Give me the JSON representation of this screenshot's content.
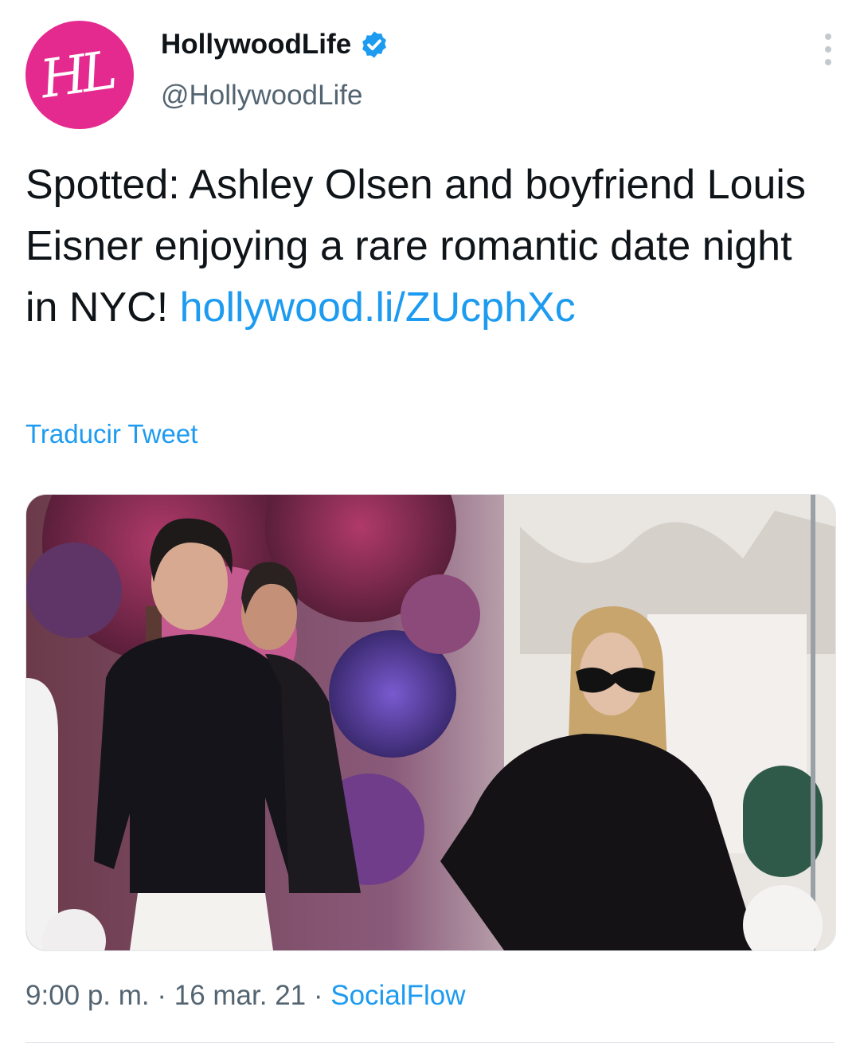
{
  "author": {
    "avatar_text": "HL",
    "display_name": "HollywoodLife",
    "handle": "@HollywoodLife",
    "verified": true,
    "brand_color": "#e52a8f"
  },
  "tweet": {
    "text_before_link": "Spotted: Ashley Olsen and boyfriend Louis Eisner enjoying a rare romantic date night in NYC! ",
    "link_text": "hollywood.li/ZUcphXc",
    "translate_label": "Traducir Tweet"
  },
  "meta": {
    "time": "9:00 p. m.",
    "separator": " · ",
    "date": "16 mar. 21",
    "source": "SocialFlow"
  },
  "colors": {
    "link": "#1d9bf0",
    "text": "#0f1419",
    "secondary": "#536471"
  },
  "icons": {
    "verified": "verified-badge-icon",
    "more": "more-vertical-icon"
  }
}
